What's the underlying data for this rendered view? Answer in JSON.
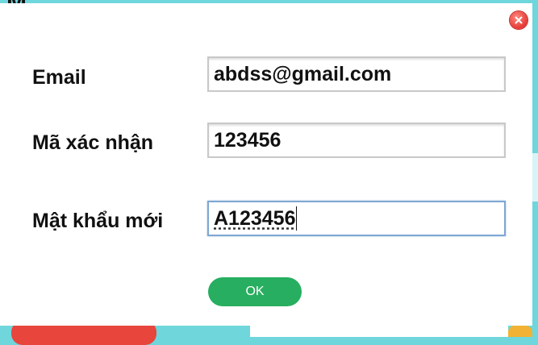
{
  "background": {
    "title_fragment": "M"
  },
  "dialog": {
    "email": {
      "label": "Email",
      "value": "abdss@gmail.com"
    },
    "code": {
      "label": "Mã xác nhận",
      "value": "123456"
    },
    "new_password": {
      "label": "Mật khẩu mới",
      "value": "A123456"
    },
    "ok_label": "OK",
    "close_icon": "close-icon"
  },
  "colors": {
    "accent_green": "#27ae60",
    "close_red": "#e53935",
    "background_teal": "#6fd6dc"
  }
}
